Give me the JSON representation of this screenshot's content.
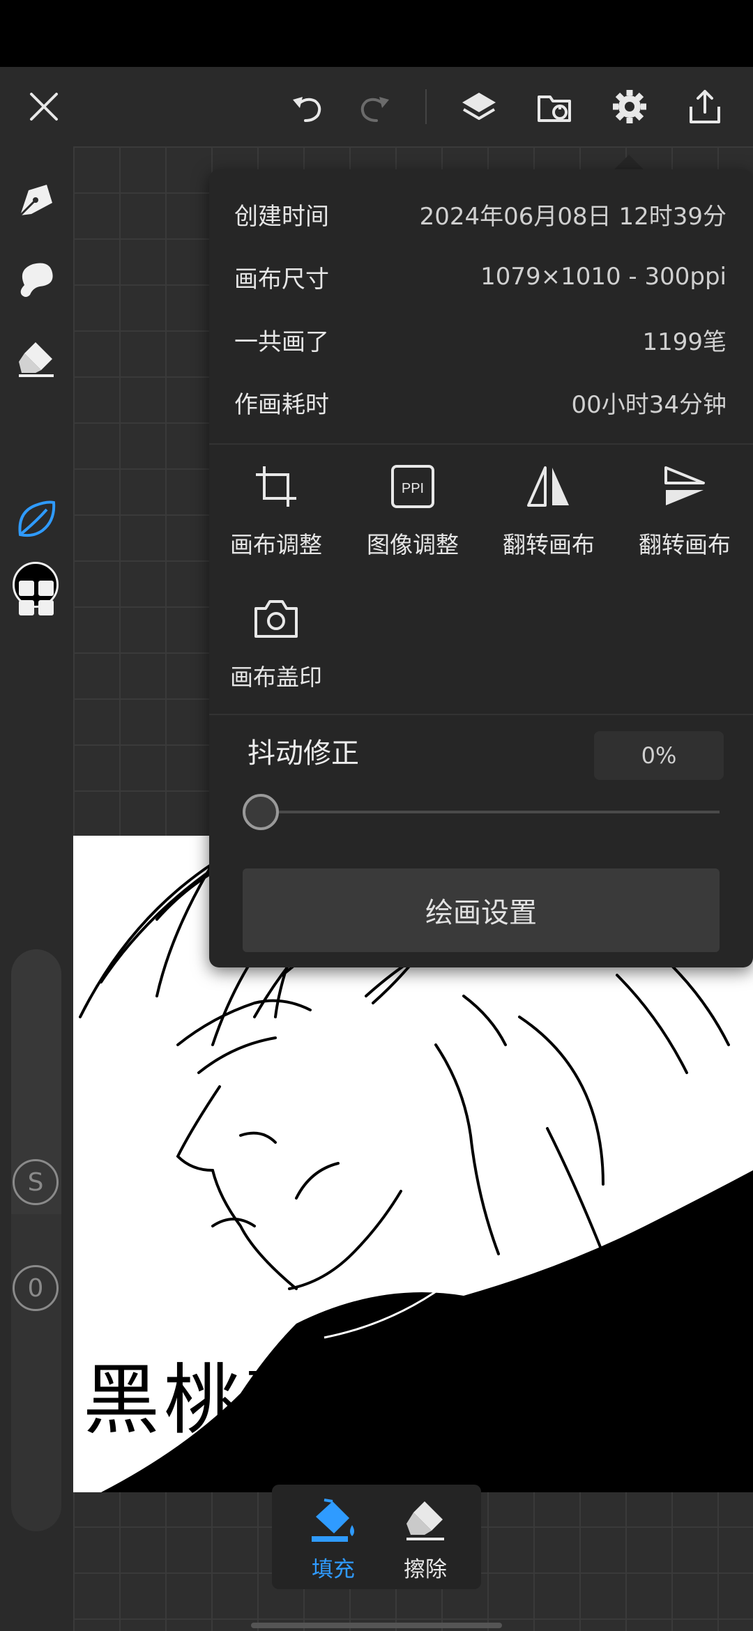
{
  "toolbar": {
    "icons": [
      "close-icon",
      "undo-icon",
      "redo-icon",
      "layers-icon",
      "import-icon",
      "settings-gear-icon",
      "share-icon"
    ]
  },
  "sidebar": {
    "icons": [
      "pen-tool-icon",
      "smudge-brush-icon",
      "eraser-icon",
      "color-swatch",
      "leaf-brush-icon",
      "grid-icon"
    ],
    "active_color": "#000000",
    "accent": "#2f9bff",
    "size_label": "S",
    "opacity_label": "0"
  },
  "panel": {
    "info": [
      {
        "key": "创建时间",
        "value": "2024年06月08日 12时39分"
      },
      {
        "key": "画布尺寸",
        "value": "1079×1010 - 300ppi"
      },
      {
        "key": "一共画了",
        "value": "1199笔"
      },
      {
        "key": "作画耗时",
        "value": "00小时34分钟"
      }
    ],
    "tools": [
      {
        "label": "画布调整",
        "icon": "crop-icon"
      },
      {
        "label": "图像调整",
        "icon": "ppi-icon"
      },
      {
        "label": "翻转画布",
        "icon": "flip-horizontal-icon"
      },
      {
        "label": "翻转画布",
        "icon": "flip-vertical-icon"
      },
      {
        "label": "画布盖印",
        "icon": "camera-icon"
      }
    ],
    "stabilizer_label": "抖动修正",
    "stabilizer_value": "0%",
    "stabilizer_level": 0,
    "settings_button": "绘画设置",
    "ppi_icon_text": "PPI"
  },
  "artwork": {
    "signature": "黑桃K"
  },
  "bottom_popup": {
    "fill_label": "填充",
    "erase_label": "擦除"
  }
}
